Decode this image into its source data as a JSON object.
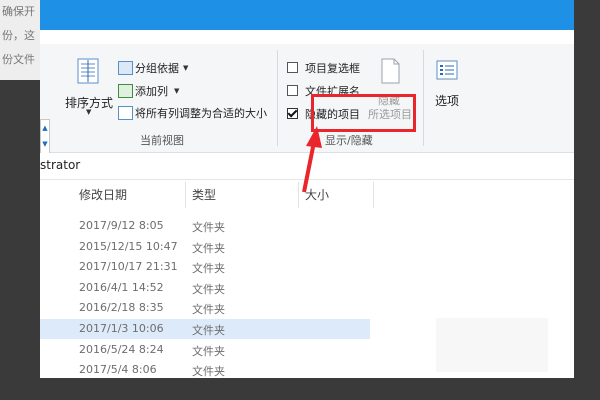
{
  "background_text": {
    "line1": "确保开",
    "line2": "份，这",
    "line3": "份文件"
  },
  "ribbon": {
    "sort_button": "排序方式",
    "group_by": "分组依据",
    "add_columns": "添加列",
    "fit_columns": "将所有列调整为合适的大小",
    "current_view_group": "当前视图",
    "item_checkboxes": "项目复选框",
    "file_extensions": "文件扩展名",
    "hidden_items": "隐藏的项目",
    "hide_selected_line1": "隐藏",
    "hide_selected_line2": "所选项目",
    "show_hide_group": "显示/隐藏",
    "options": "选项",
    "checkboxes": {
      "item_checkboxes": false,
      "file_extensions": false,
      "hidden_items": true
    }
  },
  "address": {
    "text": "strator"
  },
  "columns": {
    "modified": "修改日期",
    "type": "类型",
    "size": "大小"
  },
  "files": [
    {
      "date": "2017/9/12 8:05",
      "type": "文件夹"
    },
    {
      "date": "2015/12/15 10:47",
      "type": "文件夹"
    },
    {
      "date": "2017/10/17 21:31",
      "type": "文件夹"
    },
    {
      "date": "2016/4/1 14:52",
      "type": "文件夹"
    },
    {
      "date": "2016/2/18 8:35",
      "type": "文件夹"
    },
    {
      "date": "2017/1/3 10:06",
      "type": "文件夹",
      "selected": true
    },
    {
      "date": "2016/5/24 8:24",
      "type": "文件夹"
    },
    {
      "date": "2017/5/4 8:06",
      "type": "文件夹"
    }
  ],
  "colors": {
    "title_bar": "#1e90e6",
    "highlight": "#e8262b",
    "selected_row": "#ddeafa"
  }
}
